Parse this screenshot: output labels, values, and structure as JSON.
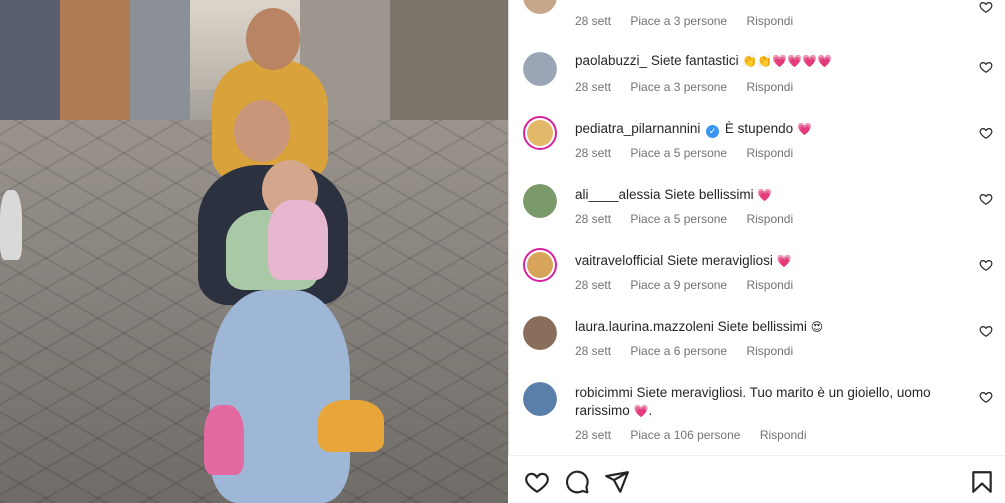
{
  "comments": [
    {
      "username": "",
      "text": "",
      "date": "28 sett",
      "likes": "Piace a 3 persone",
      "reply": "Rispondi",
      "avatar_color": "#c7a78a"
    },
    {
      "username": "paolabuzzi_",
      "text": "Siete fantastici",
      "emoji": "👏👏💗💗💗💗",
      "date": "28 sett",
      "likes": "Piace a 3 persone",
      "reply": "Rispondi",
      "avatar_color": "#9aa6b5"
    },
    {
      "username": "pediatra_pilarnannini",
      "verified": true,
      "text": "È stupendo",
      "emoji": "💗",
      "date": "28 sett",
      "likes": "Piace a 5 persone",
      "reply": "Rispondi",
      "avatar_color": "#e2b86b"
    },
    {
      "username": "ali____alessia",
      "text": "Siete bellissimi",
      "emoji": "💗",
      "date": "28 sett",
      "likes": "Piace a 5 persone",
      "reply": "Rispondi",
      "avatar_color": "#7b9a6a"
    },
    {
      "username": "vaitravelofficial",
      "text": "Siete meravigliosi",
      "emoji": "💗",
      "date": "28 sett",
      "likes": "Piace a 9 persone",
      "reply": "Rispondi",
      "avatar_color": "#d8a35a"
    },
    {
      "username": "laura.laurina.mazzoleni",
      "text": "Siete bellissimi",
      "emoji": "😍",
      "date": "28 sett",
      "likes": "Piace a 6 persone",
      "reply": "Rispondi",
      "avatar_color": "#8a6e5c"
    },
    {
      "username": "robicimmi",
      "text": "Siete meravigliosi. Tuo marito è un gioiello, uomo rarissimo",
      "emoji": "💗.",
      "date": "28 sett",
      "likes": "Piace a 106 persone",
      "reply": "Rispondi",
      "avatar_color": "#5a7fa8"
    }
  ],
  "icons": {
    "like": "heart-outline-icon",
    "comment": "speech-bubble-icon",
    "share": "paper-plane-icon",
    "save": "bookmark-icon",
    "comment_like": "small-heart-icon"
  },
  "colors": {
    "meta_text": "#737373",
    "text": "#262626",
    "verified": "#3897f0",
    "story_ring": "#d6249f"
  }
}
